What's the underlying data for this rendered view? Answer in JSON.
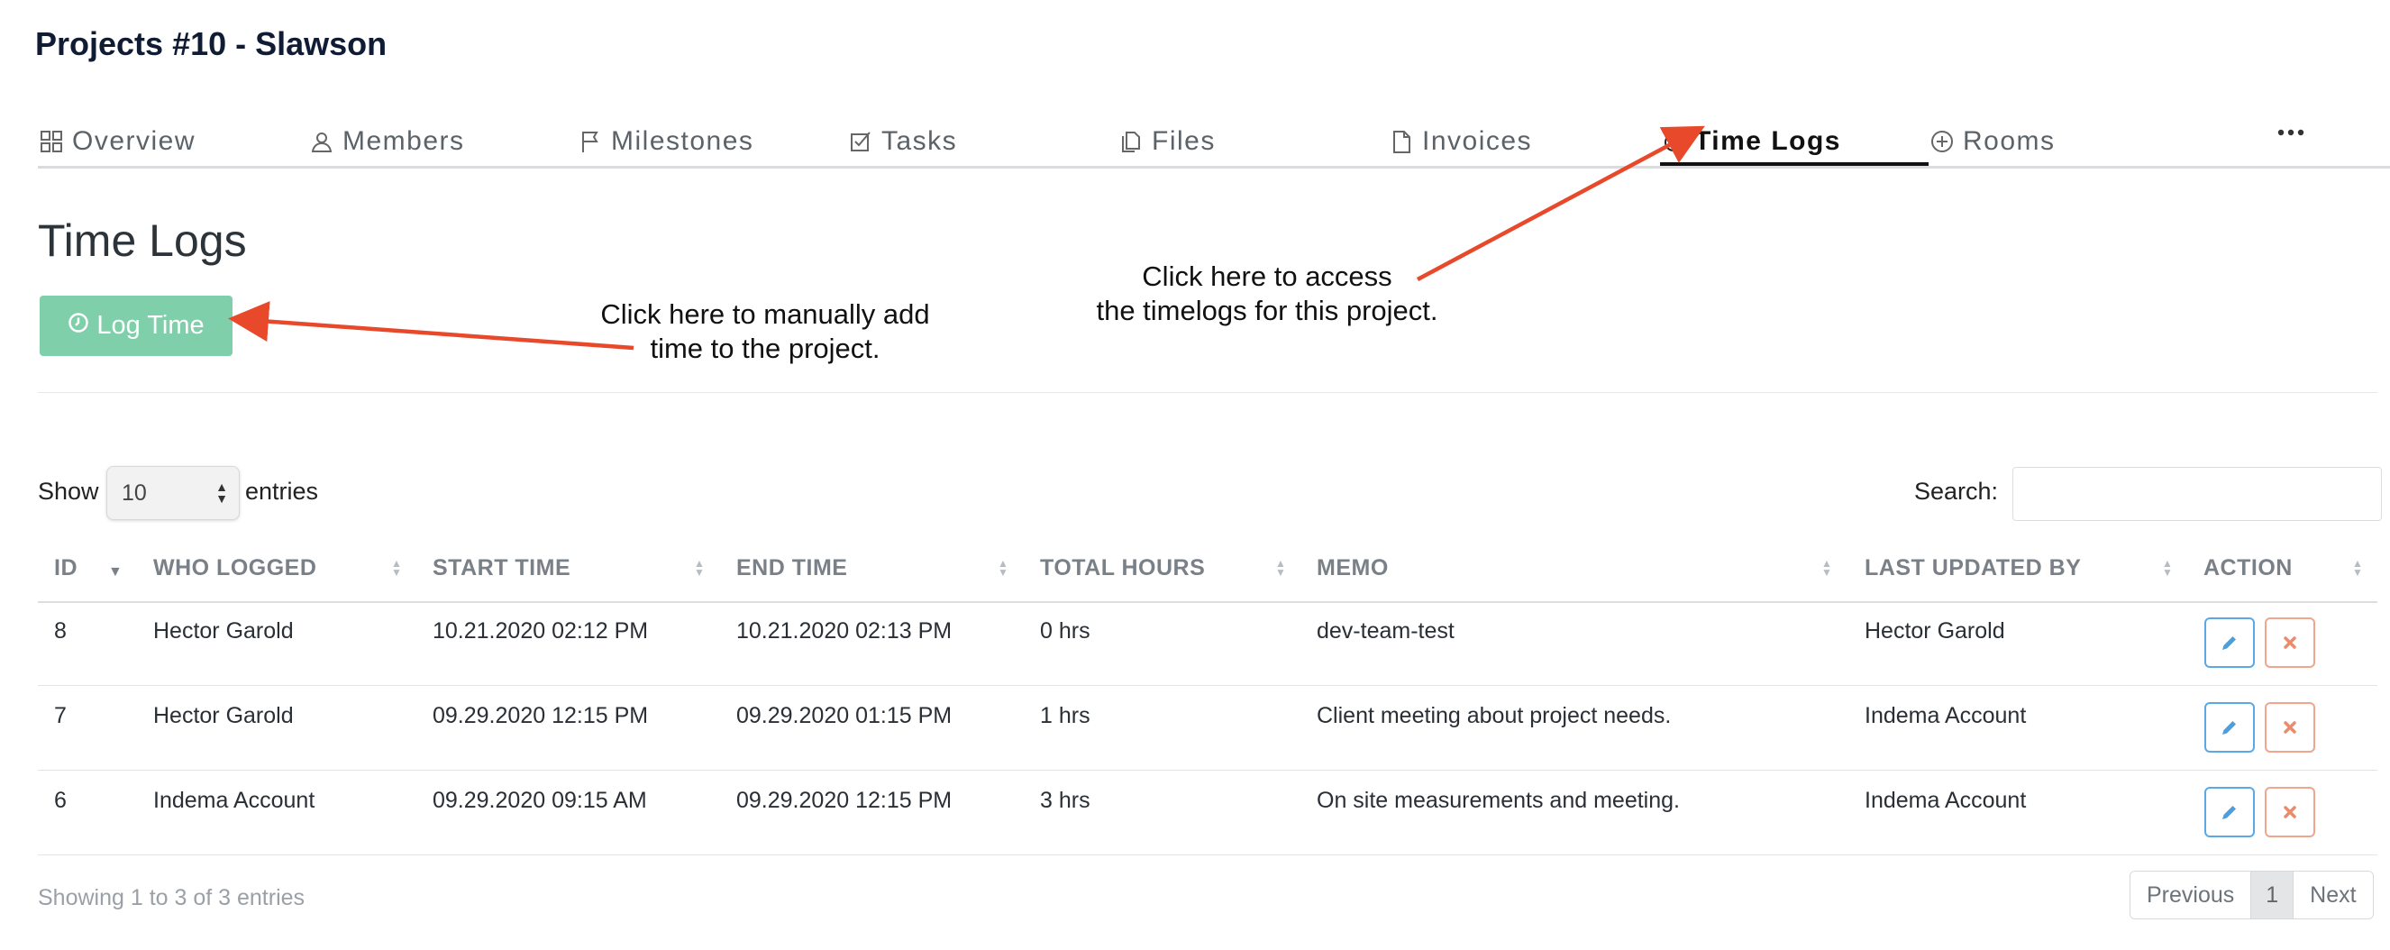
{
  "header": {
    "title": "Projects #10 - Slawson"
  },
  "tabs": [
    {
      "label": "Overview",
      "icon": "grid-icon"
    },
    {
      "label": "Members",
      "icon": "user-icon"
    },
    {
      "label": "Milestones",
      "icon": "flag-icon"
    },
    {
      "label": "Tasks",
      "icon": "checkbox-icon"
    },
    {
      "label": "Files",
      "icon": "files-icon"
    },
    {
      "label": "Invoices",
      "icon": "document-icon"
    },
    {
      "label": "Time Logs",
      "icon": "alarm-clock-icon",
      "active": true
    },
    {
      "label": "Rooms",
      "icon": "plus-circle-icon"
    }
  ],
  "main": {
    "section_title": "Time Logs",
    "log_time_button": "Log Time",
    "accent_color": "#7fcfaa"
  },
  "annotations": {
    "log_time_note": [
      "Click here to manually add",
      "time to the project."
    ],
    "time_logs_tab_note": [
      "Click here to access",
      "the timelogs for this project."
    ],
    "arrow_color": "#e8492b"
  },
  "table_controls": {
    "show_label": "Show",
    "page_size": "10",
    "entries_label": "entries",
    "search_label": "Search:",
    "search_value": ""
  },
  "table": {
    "columns": [
      "ID",
      "WHO LOGGED",
      "START TIME",
      "END TIME",
      "TOTAL HOURS",
      "MEMO",
      "LAST UPDATED BY",
      "ACTION"
    ],
    "sorted_column": "ID",
    "sort_direction": "descending",
    "rows": [
      {
        "id": "8",
        "who_logged": "Hector Garold",
        "start_time": "10.21.2020 02:12 PM",
        "end_time": "10.21.2020 02:13 PM",
        "total_hours": "0 hrs",
        "memo": "dev-team-test",
        "last_updated_by": "Hector Garold"
      },
      {
        "id": "7",
        "who_logged": "Hector Garold",
        "start_time": "09.29.2020 12:15 PM",
        "end_time": "09.29.2020 01:15 PM",
        "total_hours": "1 hrs",
        "memo": "Client meeting about project needs.",
        "last_updated_by": "Indema Account"
      },
      {
        "id": "6",
        "who_logged": "Indema Account",
        "start_time": "09.29.2020 09:15 AM",
        "end_time": "09.29.2020 12:15 PM",
        "total_hours": "3 hrs",
        "memo": "On site measurements and meeting.",
        "last_updated_by": "Indema Account"
      }
    ],
    "row_actions": [
      {
        "name": "edit",
        "icon": "pencil-icon",
        "color": "#5aa9e6"
      },
      {
        "name": "delete",
        "icon": "close-icon",
        "color": "#f0a58f"
      }
    ]
  },
  "footer": {
    "info": "Showing 1 to 3 of 3 entries",
    "pagination": {
      "previous": "Previous",
      "current": "1",
      "next": "Next"
    }
  }
}
